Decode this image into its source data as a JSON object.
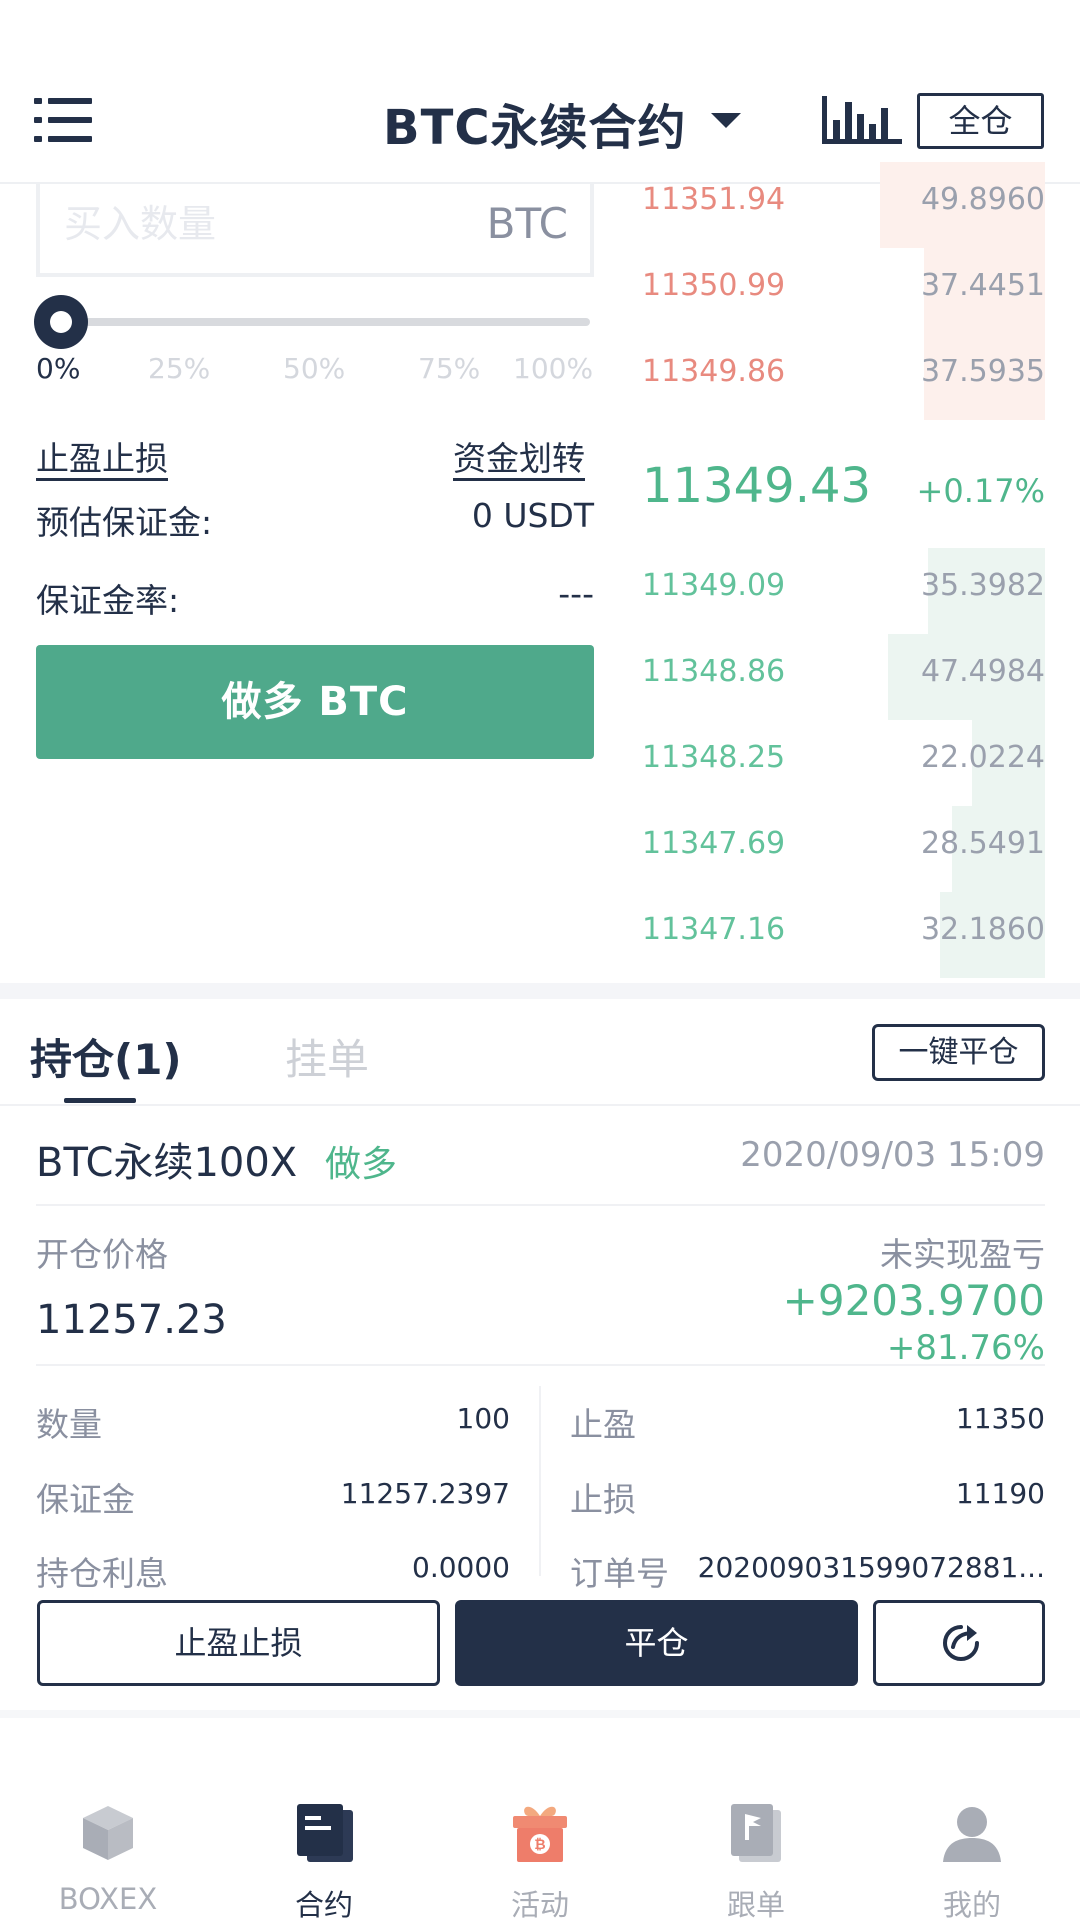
{
  "header": {
    "title": "BTC永续合约",
    "margin_mode": "全仓"
  },
  "order_form": {
    "quantity_placeholder": "买入数量",
    "quantity_unit": "BTC",
    "slider_percent": 0,
    "percent_options": [
      "0%",
      "25%",
      "50%",
      "75%",
      "100%"
    ],
    "tp_sl_link": "止盈止损",
    "transfer_link": "资金划转",
    "est_margin_label": "预估保证金:",
    "est_margin_value": "0 USDT",
    "margin_rate_label": "保证金率:",
    "margin_rate_value": "---",
    "long_button": "做多 BTC"
  },
  "order_book": {
    "asks": [
      {
        "price": "11351.94",
        "amount": "49.8960",
        "depth": 0.41
      },
      {
        "price": "11350.99",
        "amount": "37.4451",
        "depth": 0.3
      },
      {
        "price": "11349.86",
        "amount": "37.5935",
        "depth": 0.3
      }
    ],
    "last_price": "11349.43",
    "change": "+0.17%",
    "bids": [
      {
        "price": "11349.09",
        "amount": "35.3982",
        "depth": 0.29
      },
      {
        "price": "11348.86",
        "amount": "47.4984",
        "depth": 0.39
      },
      {
        "price": "11348.25",
        "amount": "22.0224",
        "depth": 0.18
      },
      {
        "price": "11347.69",
        "amount": "28.5491",
        "depth": 0.23
      },
      {
        "price": "11347.16",
        "amount": "32.1860",
        "depth": 0.26
      }
    ]
  },
  "tabs": {
    "positions": "持仓(1)",
    "orders": "挂单",
    "close_all": "一键平仓"
  },
  "position": {
    "symbol": "BTC永续100X",
    "side": "做多",
    "time": "2020/09/03 15:09",
    "open_price_label": "开仓价格",
    "open_price": "11257.23",
    "pnl_label": "未实现盈亏",
    "pnl": "+9203.9700",
    "pnl_pct": "+81.76%",
    "qty_label": "数量",
    "qty": "100",
    "margin_label": "保证金",
    "margin": "11257.2397",
    "interest_label": "持仓利息",
    "interest": "0.0000",
    "tp_label": "止盈",
    "tp": "11350",
    "sl_label": "止损",
    "sl": "11190",
    "order_no_label": "订单号",
    "order_no": "202009031599072881...",
    "tp_sl_button": "止盈止损",
    "close_button": "平仓"
  },
  "nav": {
    "items": [
      {
        "label": "BOXEX",
        "icon": "cube-icon"
      },
      {
        "label": "合约",
        "icon": "contract-icon"
      },
      {
        "label": "活动",
        "icon": "gift-icon"
      },
      {
        "label": "跟单",
        "icon": "copy-trade-icon"
      },
      {
        "label": "我的",
        "icon": "user-icon"
      }
    ],
    "active_index": 1
  },
  "colors": {
    "primary": "#233048",
    "green": "#4fa98b",
    "ask_red": "#e88a7f",
    "bid_green": "#62c29b"
  }
}
